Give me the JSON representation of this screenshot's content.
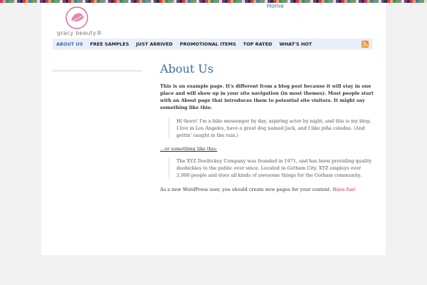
{
  "header": {
    "home_link": "Home",
    "logo_text": "gracy beauty®"
  },
  "nav": {
    "items": [
      {
        "label": "About Us"
      },
      {
        "label": "Free Samples"
      },
      {
        "label": "Just Arrived"
      },
      {
        "label": "Promotional Items"
      },
      {
        "label": "Top Rated"
      },
      {
        "label": "What's Hot"
      }
    ],
    "rss_icon": "rss-icon"
  },
  "main": {
    "title": "About Us",
    "lead": "This is an example page. It's different from a blog post because it will stay in one place and will show up in your site navigation (in most themes). Most people start with an About page that introduces them to potential site visitors. It might say something like this:",
    "quote1": "Hi there! I'm a bike messenger by day, aspiring actor by night, and this is my blog. I live in Los Angeles, have a great dog named Jack, and I like piña coladas. (And gettin' caught in the rain.)",
    "or_text": "...or something like this:",
    "quote2": "The XYZ Doohickey Company was founded in 1971, and has been providing quality doohickies to the public ever since. Located in Gotham City, XYZ employs over 2,000 people and does all kinds of awesome things for the Gotham community.",
    "closing_text": "As a new WordPress user, you should create new pages for your content.",
    "have_fun": "Have fun!"
  },
  "colors": {
    "accent": "#3a6ea5",
    "link_red": "#d21f3c",
    "nav_bg": "#e9eefb"
  }
}
